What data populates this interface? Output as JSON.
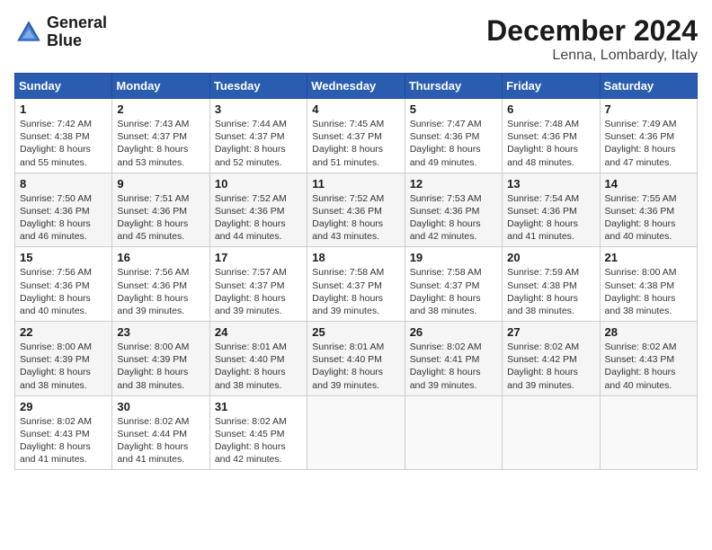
{
  "header": {
    "logo_line1": "General",
    "logo_line2": "Blue",
    "month": "December 2024",
    "location": "Lenna, Lombardy, Italy"
  },
  "weekdays": [
    "Sunday",
    "Monday",
    "Tuesday",
    "Wednesday",
    "Thursday",
    "Friday",
    "Saturday"
  ],
  "weeks": [
    [
      {
        "day": "1",
        "sunrise": "7:42 AM",
        "sunset": "4:38 PM",
        "daylight": "8 hours and 55 minutes."
      },
      {
        "day": "2",
        "sunrise": "7:43 AM",
        "sunset": "4:37 PM",
        "daylight": "8 hours and 53 minutes."
      },
      {
        "day": "3",
        "sunrise": "7:44 AM",
        "sunset": "4:37 PM",
        "daylight": "8 hours and 52 minutes."
      },
      {
        "day": "4",
        "sunrise": "7:45 AM",
        "sunset": "4:37 PM",
        "daylight": "8 hours and 51 minutes."
      },
      {
        "day": "5",
        "sunrise": "7:47 AM",
        "sunset": "4:36 PM",
        "daylight": "8 hours and 49 minutes."
      },
      {
        "day": "6",
        "sunrise": "7:48 AM",
        "sunset": "4:36 PM",
        "daylight": "8 hours and 48 minutes."
      },
      {
        "day": "7",
        "sunrise": "7:49 AM",
        "sunset": "4:36 PM",
        "daylight": "8 hours and 47 minutes."
      }
    ],
    [
      {
        "day": "8",
        "sunrise": "7:50 AM",
        "sunset": "4:36 PM",
        "daylight": "8 hours and 46 minutes."
      },
      {
        "day": "9",
        "sunrise": "7:51 AM",
        "sunset": "4:36 PM",
        "daylight": "8 hours and 45 minutes."
      },
      {
        "day": "10",
        "sunrise": "7:52 AM",
        "sunset": "4:36 PM",
        "daylight": "8 hours and 44 minutes."
      },
      {
        "day": "11",
        "sunrise": "7:52 AM",
        "sunset": "4:36 PM",
        "daylight": "8 hours and 43 minutes."
      },
      {
        "day": "12",
        "sunrise": "7:53 AM",
        "sunset": "4:36 PM",
        "daylight": "8 hours and 42 minutes."
      },
      {
        "day": "13",
        "sunrise": "7:54 AM",
        "sunset": "4:36 PM",
        "daylight": "8 hours and 41 minutes."
      },
      {
        "day": "14",
        "sunrise": "7:55 AM",
        "sunset": "4:36 PM",
        "daylight": "8 hours and 40 minutes."
      }
    ],
    [
      {
        "day": "15",
        "sunrise": "7:56 AM",
        "sunset": "4:36 PM",
        "daylight": "8 hours and 40 minutes."
      },
      {
        "day": "16",
        "sunrise": "7:56 AM",
        "sunset": "4:36 PM",
        "daylight": "8 hours and 39 minutes."
      },
      {
        "day": "17",
        "sunrise": "7:57 AM",
        "sunset": "4:37 PM",
        "daylight": "8 hours and 39 minutes."
      },
      {
        "day": "18",
        "sunrise": "7:58 AM",
        "sunset": "4:37 PM",
        "daylight": "8 hours and 39 minutes."
      },
      {
        "day": "19",
        "sunrise": "7:58 AM",
        "sunset": "4:37 PM",
        "daylight": "8 hours and 38 minutes."
      },
      {
        "day": "20",
        "sunrise": "7:59 AM",
        "sunset": "4:38 PM",
        "daylight": "8 hours and 38 minutes."
      },
      {
        "day": "21",
        "sunrise": "8:00 AM",
        "sunset": "4:38 PM",
        "daylight": "8 hours and 38 minutes."
      }
    ],
    [
      {
        "day": "22",
        "sunrise": "8:00 AM",
        "sunset": "4:39 PM",
        "daylight": "8 hours and 38 minutes."
      },
      {
        "day": "23",
        "sunrise": "8:00 AM",
        "sunset": "4:39 PM",
        "daylight": "8 hours and 38 minutes."
      },
      {
        "day": "24",
        "sunrise": "8:01 AM",
        "sunset": "4:40 PM",
        "daylight": "8 hours and 38 minutes."
      },
      {
        "day": "25",
        "sunrise": "8:01 AM",
        "sunset": "4:40 PM",
        "daylight": "8 hours and 39 minutes."
      },
      {
        "day": "26",
        "sunrise": "8:02 AM",
        "sunset": "4:41 PM",
        "daylight": "8 hours and 39 minutes."
      },
      {
        "day": "27",
        "sunrise": "8:02 AM",
        "sunset": "4:42 PM",
        "daylight": "8 hours and 39 minutes."
      },
      {
        "day": "28",
        "sunrise": "8:02 AM",
        "sunset": "4:43 PM",
        "daylight": "8 hours and 40 minutes."
      }
    ],
    [
      {
        "day": "29",
        "sunrise": "8:02 AM",
        "sunset": "4:43 PM",
        "daylight": "8 hours and 41 minutes."
      },
      {
        "day": "30",
        "sunrise": "8:02 AM",
        "sunset": "4:44 PM",
        "daylight": "8 hours and 41 minutes."
      },
      {
        "day": "31",
        "sunrise": "8:02 AM",
        "sunset": "4:45 PM",
        "daylight": "8 hours and 42 minutes."
      },
      null,
      null,
      null,
      null
    ]
  ],
  "labels": {
    "sunrise": "Sunrise:",
    "sunset": "Sunset:",
    "daylight": "Daylight:"
  }
}
